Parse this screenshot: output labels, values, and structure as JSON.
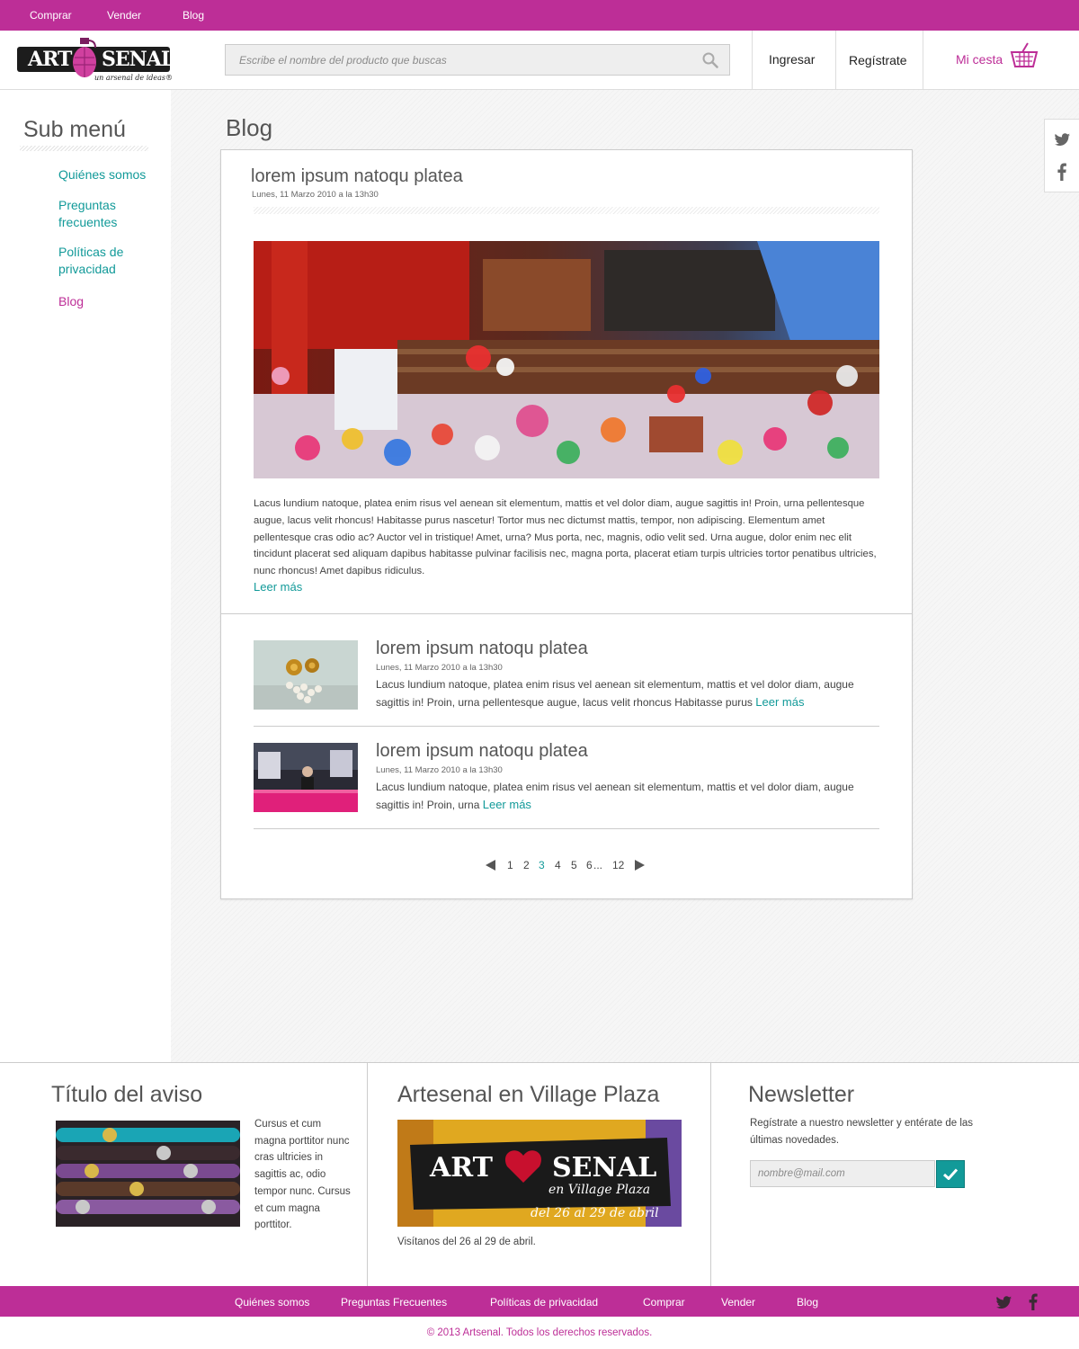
{
  "topnav": {
    "items": [
      "Comprar",
      "Vender",
      "Blog"
    ]
  },
  "header": {
    "logo": {
      "word1": "ART",
      "word2": "SENAL",
      "tagline": "un arsenal de ideas®"
    },
    "search": {
      "placeholder": "Escribe el nombre del producto que buscas"
    },
    "login_label": "Ingresar",
    "register_label": "Regístrate",
    "cart_label": "Mi cesta"
  },
  "sidebar": {
    "title": "Sub menú",
    "items": [
      {
        "label": "Quiénes somos",
        "active": false
      },
      {
        "label": "Preguntas frecuentes",
        "active": false
      },
      {
        "label": "Políticas de privacidad",
        "active": false
      },
      {
        "label": "Blog",
        "active": true
      }
    ]
  },
  "main": {
    "page_title": "Blog",
    "featured": {
      "title": "lorem ipsum natoqu platea",
      "date": "Lunes, 11 Marzo 2010 a la 13h30",
      "body": "Lacus lundium natoque, platea enim risus vel aenean sit elementum, mattis et vel dolor diam, augue sagittis in! Proin, urna pellentesque augue, lacus velit rhoncus! Habitasse purus nascetur! Tortor mus nec dictumst mattis, tempor, non adipiscing. Elementum amet pellentesque cras odio ac? Auctor vel in tristique! Amet, urna? Mus porta, nec, magnis, odio velit sed. Urna augue, dolor enim nec elit tincidunt placerat sed aliquam dapibus habitasse pulvinar facilisis nec, magna porta, placerat etiam turpis ultricies tortor penatibus ultricies, nunc rhoncus! Amet dapibus ridiculus.",
      "read_more": "Leer más"
    },
    "posts": [
      {
        "title": "lorem ipsum natoqu platea",
        "date": "Lunes, 11 Marzo 2010 a la 13h30",
        "body": "Lacus lundium natoque, platea enim risus vel aenean sit elementum, mattis et vel dolor diam, augue sagittis in! Proin, urna pellentesque augue, lacus velit rhoncus Habitasse purus",
        "read_more": "Leer más"
      },
      {
        "title": "lorem ipsum natoqu platea",
        "date": "Lunes, 11 Marzo 2010 a la 13h30",
        "body": "Lacus lundium natoque, platea enim risus vel aenean sit elementum, mattis et vel dolor diam, augue sagittis in! Proin, urna",
        "read_more": "Leer más"
      }
    ],
    "pagination": {
      "pages": [
        "1",
        "2",
        "3",
        "4",
        "5",
        "6",
        "12"
      ],
      "ellipsis": "...",
      "current": "3"
    }
  },
  "footer": {
    "notice": {
      "title": "Título del aviso",
      "text": "Cursus et cum magna porttitor nunc cras ultricies in sagittis ac, odio tempor nunc. Cursus et cum magna porttitor."
    },
    "event": {
      "title": "Artesenal en Village Plaza",
      "banner_word1": "ART",
      "banner_word2": "SENAL",
      "banner_sub": "en Village Plaza",
      "banner_dates": "del 26 al 29 de abril",
      "caption": "Visítanos del 26 al 29 de abril."
    },
    "newsletter": {
      "title": "Newsletter",
      "text": "Regístrate a nuestro newsletter y entérate de las últimas novedades.",
      "placeholder": "nombre@mail.com"
    }
  },
  "bottomnav": {
    "items": [
      "Quiénes somos",
      "Preguntas Frecuentes",
      "Políticas de privacidad",
      "Comprar",
      "Vender",
      "Blog"
    ]
  },
  "copyright": "© 2013 Artsenal. Todos los derechos reservados.",
  "colors": {
    "brand": "#bd2e97",
    "accent": "#129a99"
  },
  "icons": [
    "search-icon",
    "basket-icon",
    "twitter-icon",
    "facebook-icon",
    "check-icon",
    "prev-arrow-icon",
    "next-arrow-icon"
  ]
}
